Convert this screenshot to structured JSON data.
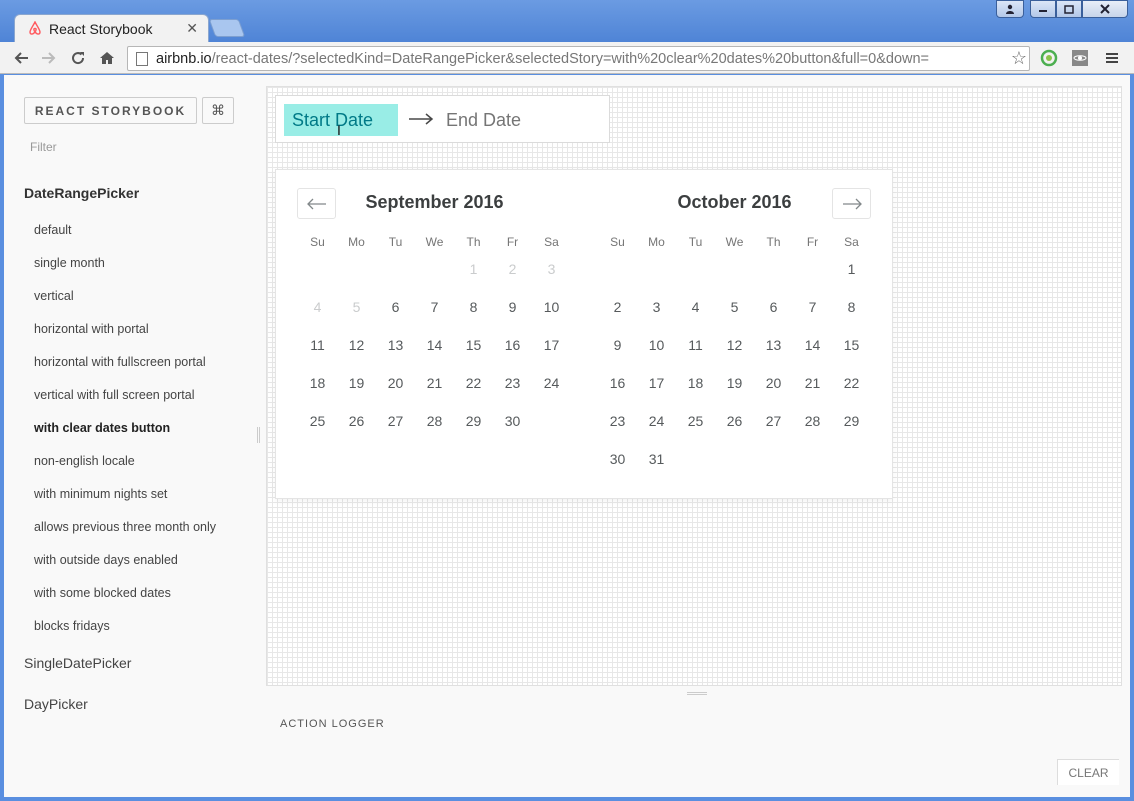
{
  "browser": {
    "tab_title": "React Storybook",
    "tab_close": "✕",
    "url_host": "airbnb.io",
    "url_path": "/react-dates/?selectedKind=DateRangePicker&selectedStory=with%20clear%20dates%20button&full=0&down="
  },
  "sidebar": {
    "title_button": "REACT STORYBOOK",
    "shortcut_button": "⌘",
    "filter_placeholder": "Filter",
    "kinds": [
      {
        "label": "DateRangePicker",
        "active": true,
        "stories": [
          "default",
          "single month",
          "vertical",
          "horizontal with portal",
          "horizontal with fullscreen portal",
          "vertical with full screen portal",
          "with clear dates button",
          "non-english locale",
          "with minimum nights set",
          "allows previous three month only",
          "with outside days enabled",
          "with some blocked dates",
          "blocks fridays"
        ]
      },
      {
        "label": "SingleDatePicker",
        "active": false
      },
      {
        "label": "DayPicker",
        "active": false
      }
    ],
    "selected_story": "with clear dates button"
  },
  "picker": {
    "start_date": "Start Date",
    "end_date": "End Date",
    "arrow": "⟶",
    "prev_icon": "←",
    "next_icon": "→",
    "weekdays": [
      "Su",
      "Mo",
      "Tu",
      "We",
      "Th",
      "Fr",
      "Sa"
    ],
    "months": [
      {
        "title": "September 2016",
        "first_weekday": 4,
        "days": 30,
        "blocked_before": 6
      },
      {
        "title": "October 2016",
        "first_weekday": 6,
        "days": 31,
        "blocked_before": 0
      }
    ]
  },
  "logger": {
    "title": "ACTION LOGGER",
    "clear_button": "CLEAR"
  },
  "colors": {
    "selected_input_bg": "#99ede6",
    "selected_input_text": "#007a87",
    "blocked_day": "#cacccd"
  }
}
